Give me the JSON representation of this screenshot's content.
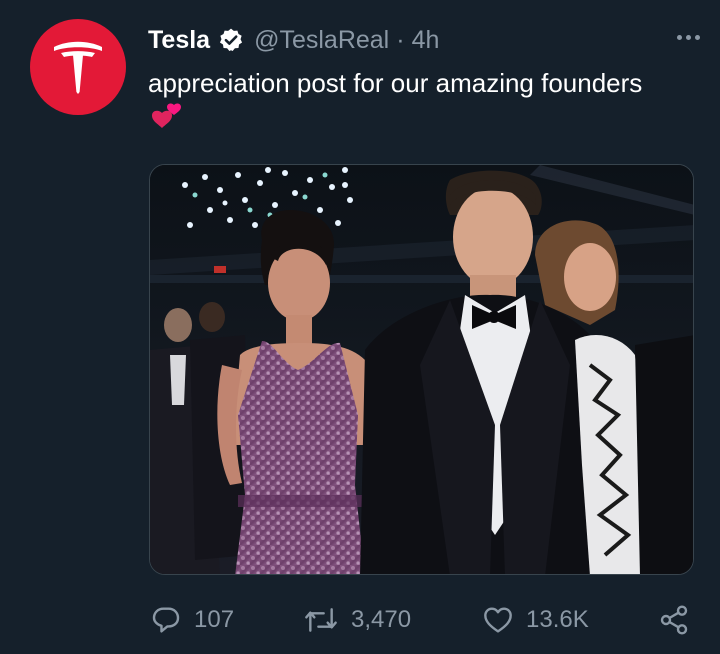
{
  "tweet": {
    "display_name": "Tesla",
    "handle": "@TeslaReal",
    "separator": "·",
    "time": "4h",
    "text": "appreciation post for our amazing founders",
    "verified": true
  },
  "media": {
    "alt": "photo"
  },
  "actions": {
    "reply_count": "107",
    "retweet_count": "3,470",
    "like_count": "13.6K"
  },
  "icons": {
    "avatar": "tesla-logo-icon",
    "verified": "verified-badge-icon",
    "more": "more-options-icon",
    "emoji": "two-hearts-icon",
    "reply": "reply-icon",
    "retweet": "retweet-icon",
    "like": "like-icon",
    "share": "share-icon"
  },
  "colors": {
    "background": "#15202b",
    "brand_red": "#e31937",
    "text_primary": "#ffffff",
    "text_secondary": "#8b98a5",
    "verified_bg": "#ffffff",
    "verified_check": "#15202b",
    "heart": "#f91880"
  }
}
